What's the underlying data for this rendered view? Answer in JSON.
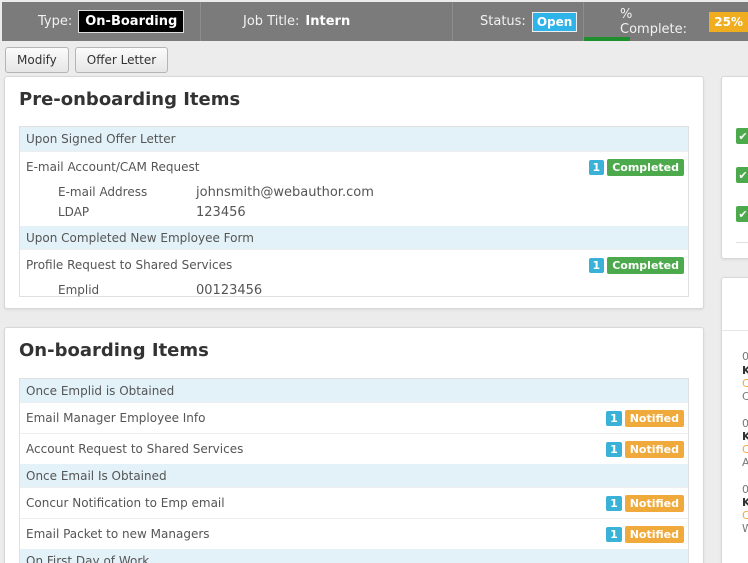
{
  "header": {
    "type_label": "Type:",
    "type_value": "On-Boarding",
    "job_title_label": "Job Title:",
    "job_title_value": "Intern",
    "status_label": "Status:",
    "status_value": "Open",
    "complete_label": "% Complete:",
    "complete_value": "25%",
    "complete_fraction": 0.25
  },
  "toolbar": {
    "modify_label": "Modify",
    "offer_letter_label": "Offer Letter"
  },
  "pre": {
    "title": "Pre-onboarding Items",
    "s1_head": "Upon Signed Offer Letter",
    "r1_label": "E-mail Account/CAM Request",
    "r1_count": "1",
    "r1_status": "Completed",
    "d1_k": "E-mail Address",
    "d1_v": "johnsmith@webauthor.com",
    "d2_k": "LDAP",
    "d2_v": "123456",
    "s2_head": "Upon Completed New Employee Form",
    "r2_label": "Profile Request to Shared Services",
    "r2_count": "1",
    "r2_status": "Completed",
    "d3_k": "Emplid",
    "d3_v": "00123456"
  },
  "on": {
    "title": "On-boarding Items",
    "s1_head": "Once Emplid is Obtained",
    "r1_label": "Email Manager Employee Info",
    "r2_label": "Account Request to Shared Services",
    "s2_head": "Once Email Is Obtained",
    "r3_label": "Concur Notification to Emp email",
    "r4_label": "Email Packet to new Managers",
    "s3_head": "On First Day of Work",
    "count": "1",
    "status": "Notified"
  },
  "side": {
    "a1": "0",
    "a2": "K",
    "a3": "C",
    "a4": "C",
    "b1": "0",
    "b2": "K",
    "b3": "C",
    "b4": "A",
    "c1": "0",
    "c2": "K",
    "c3": "C",
    "c4": "W"
  },
  "colors": {
    "header_bg": "#7b7b7b",
    "status_open": "#2fb4e9",
    "percent": "#f0ad1f",
    "completed": "#4caa4c",
    "notified": "#f0a93b",
    "count": "#3ab1d7",
    "section_bg": "#e3f1f8"
  }
}
